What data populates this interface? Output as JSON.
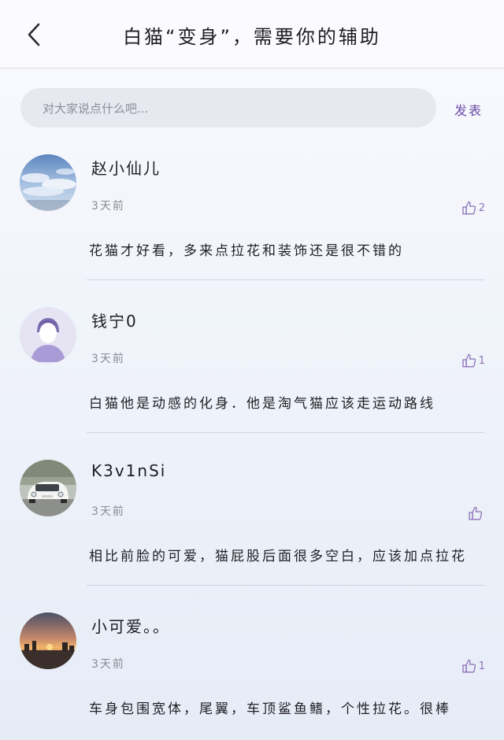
{
  "header": {
    "title": "白猫“变身”，需要你的辅助"
  },
  "comment_bar": {
    "placeholder": "对大家说点什么吧...",
    "post_label": "发表"
  },
  "comments": [
    {
      "name": "赵小仙儿",
      "time": "3天前",
      "likes": "2",
      "content": "花猫才好看，多来点拉花和装饰还是很不错的",
      "avatar": "sky-clouds-avatar"
    },
    {
      "name": "钱宁0",
      "time": "3天前",
      "likes": "1",
      "content": "白猫他是动感的化身．他是淘气猫应该走运动路线",
      "avatar": "default-person-avatar"
    },
    {
      "name": "K3v1nSi",
      "time": "3天前",
      "likes": "",
      "content": "相比前脸的可爱，猫屁股后面很多空白，应该加点拉花",
      "avatar": "white-car-avatar"
    },
    {
      "name": "小可爱。。",
      "time": "3天前",
      "likes": "1",
      "content": "车身包围宽体，尾翼，车顶鲨鱼鳍，个性拉花。很棒",
      "avatar": "sunset-avatar"
    }
  ],
  "colors": {
    "accent": "#6c4ba6",
    "like_icon": "#8b72b8",
    "divider": "#cdd4e6",
    "input_bg": "#e7e9f1"
  },
  "icons": {
    "back": "chevron-left-icon",
    "like": "thumbs-up-icon"
  }
}
